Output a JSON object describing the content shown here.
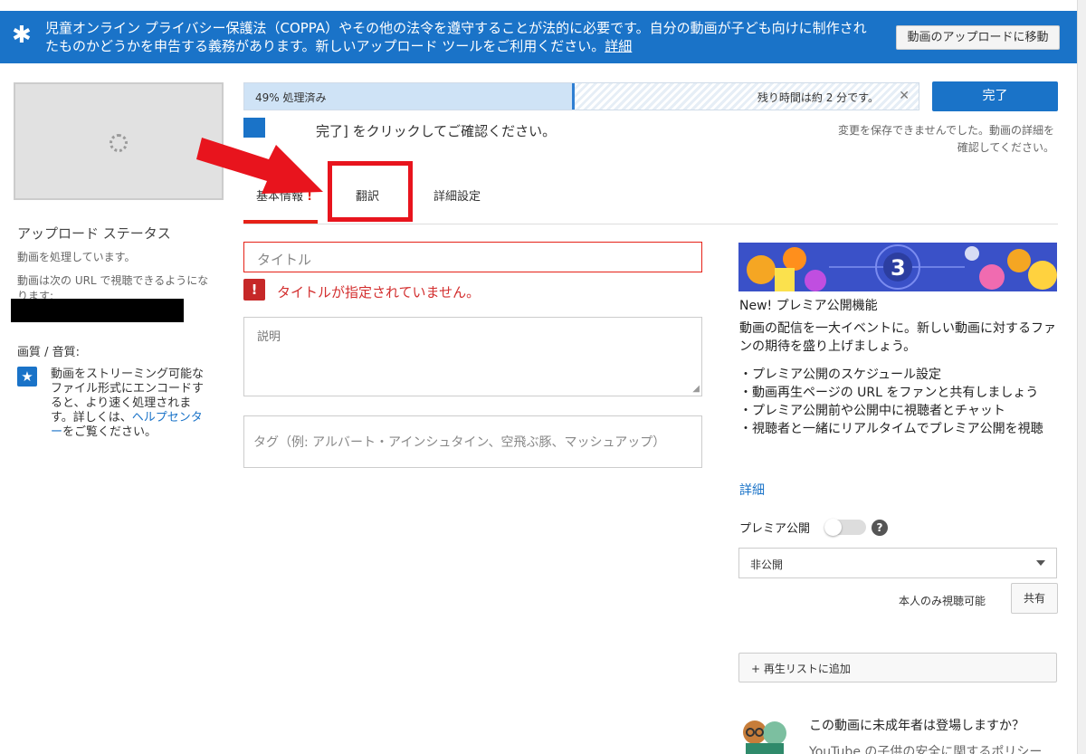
{
  "banner": {
    "text": "児童オンライン プライバシー保護法（COPPA）やその他の法令を遵守することが法的に必要です。自分の動画が子ども向けに制作されたものかどうかを申告する義務があります。新しいアップロード ツールをご利用ください。",
    "link": "詳細",
    "move_button": "動画のアップロードに移動",
    "icon": "star-icon"
  },
  "left": {
    "upload_status_title": "アップロード ステータス",
    "processing": "動画を処理しています。",
    "url_note": "動画は次の URL で視聴できるようになります:",
    "quality_title": "画質 / 音質:",
    "quality_text": "動画をストリーミング可能なファイル形式にエンコードすると、より速く処理されます。詳しくは、",
    "quality_link": "ヘルプセンター",
    "quality_tail": "をご覧ください。"
  },
  "progress": {
    "value": 49,
    "label": "49% 処理済み",
    "remaining": "残り時間は約 2 分です。"
  },
  "done_button": "完了",
  "save_error": "変更を保存できませんでした。動画の詳細を確認してください。",
  "confirm_text": "完了] をクリックしてご確認ください。",
  "tabs": [
    {
      "label": "基本情報",
      "alert": "!"
    },
    {
      "label": "翻訳"
    },
    {
      "label": "詳細設定"
    }
  ],
  "form": {
    "title_placeholder": "タイトル",
    "title_error": "タイトルが指定されていません。",
    "description_placeholder": "説明",
    "tags_placeholder": "タグ（例: アルバート・アインシュタイン、空飛ぶ豚、マッシュアップ）"
  },
  "promo": {
    "countdown": "3",
    "title": "New! プレミア公開機能",
    "description": "動画の配信を一大イベントに。新しい動画に対するファンの期待を盛り上げましょう。",
    "items": [
      "・プレミア公開のスケジュール設定",
      "・動画再生ページの URL をファンと共有しましょう",
      "・プレミア公開前や公開中に視聴者とチャット",
      "・視聴者と一緒にリアルタイムでプレミア公開を視聴"
    ],
    "link": "詳細"
  },
  "premiere": {
    "label": "プレミア公開",
    "enabled": false,
    "help": "?"
  },
  "privacy": {
    "selected": "非公開",
    "note": "本人のみ視聴可能",
    "share_button": "共有"
  },
  "playlist_button": "+ 再生リストに追加",
  "kids": {
    "question": "この動画に未成年者は登場しますか？",
    "sub": "YouTube の子供の安全に関するポリシー"
  },
  "colors": {
    "brand_blue": "#1a73c8",
    "error_red": "#e62117",
    "annotation_red": "#e8141d"
  }
}
